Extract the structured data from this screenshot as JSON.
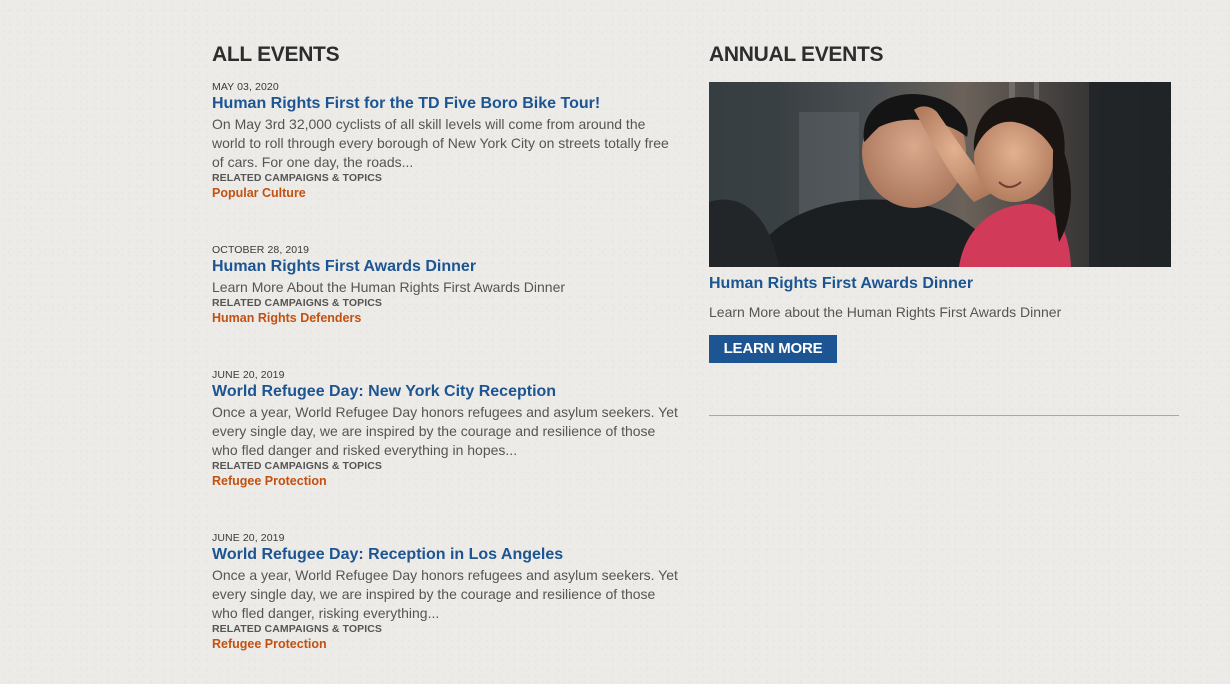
{
  "all_events": {
    "heading": "ALL EVENTS",
    "related_label": "RELATED CAMPAIGNS & TOPICS",
    "items": [
      {
        "date": "MAY 03, 2020",
        "title": "Human Rights First for the TD Five Boro Bike Tour!",
        "description": "On May 3rd 32,000 cyclists of all skill levels will come from around the world to roll through every borough of New York City on streets totally free of cars. For one day, the roads...",
        "topic": "Popular Culture"
      },
      {
        "date": "OCTOBER 28, 2019",
        "title": "Human Rights First Awards Dinner",
        "description": "Learn More About the Human Rights First Awards Dinner",
        "topic": "Human Rights Defenders"
      },
      {
        "date": "JUNE 20, 2019",
        "title": "World Refugee Day: New York City Reception",
        "description": "Once a year, World Refugee Day honors refugees and asylum seekers. Yet every single day, we are inspired by the courage and resilience of those who fled danger and risked everything in hopes...",
        "topic": "Refugee Protection"
      },
      {
        "date": "JUNE 20, 2019",
        "title": "World Refugee Day: Reception in Los Angeles",
        "description": "Once a year, World Refugee Day honors refugees and asylum seekers. Yet every single day, we are inspired by the courage and resilience of those who fled danger, risking everything...",
        "topic": "Refugee Protection"
      }
    ]
  },
  "annual_events": {
    "heading": "ANNUAL EVENTS",
    "feature": {
      "title": "Human Rights First Awards Dinner",
      "description": "Learn More about the Human Rights First Awards Dinner",
      "button_label": "LEARN MORE"
    }
  },
  "colors": {
    "link_blue": "#1c5592",
    "topic_orange": "#c4500f",
    "button_blue": "#1c5592",
    "background": "#ecebe7"
  }
}
